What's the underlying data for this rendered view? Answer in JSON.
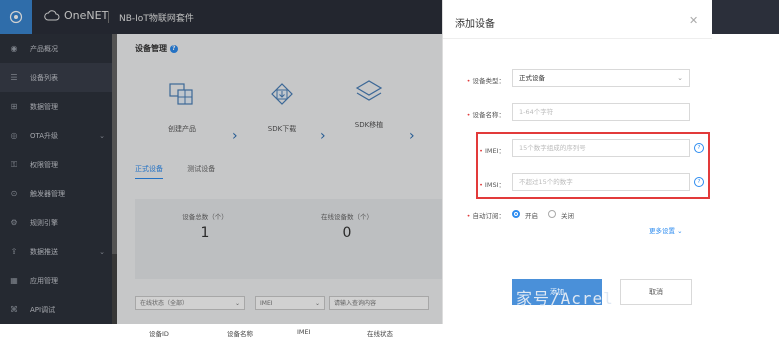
{
  "header": {
    "brand": "OneNET",
    "suite": "NB-IoT物联网套件"
  },
  "sidebar": {
    "items": [
      {
        "label": "产品概况",
        "icon": "dashboard-icon"
      },
      {
        "label": "设备列表",
        "icon": "list-icon",
        "active": true
      },
      {
        "label": "数据管理",
        "icon": "grid-icon"
      },
      {
        "label": "OTA升级",
        "icon": "upgrade-icon",
        "expandable": true
      },
      {
        "label": "权限管理",
        "icon": "key-icon"
      },
      {
        "label": "触发器管理",
        "icon": "trigger-icon"
      },
      {
        "label": "规则引擎",
        "icon": "rule-icon"
      },
      {
        "label": "数据推送",
        "icon": "push-icon",
        "expandable": true
      },
      {
        "label": "应用管理",
        "icon": "apps-icon"
      },
      {
        "label": "API调试",
        "icon": "api-icon"
      }
    ]
  },
  "main": {
    "title": "设备管理",
    "steps": [
      {
        "label": "创建产品"
      },
      {
        "label": "SDK下载"
      },
      {
        "label": "SDK移植"
      }
    ],
    "tabs": [
      {
        "label": "正式设备",
        "active": true
      },
      {
        "label": "测试设备",
        "active": false
      }
    ],
    "stats": [
      {
        "label": "设备总数（个）",
        "value": "1"
      },
      {
        "label": "在线设备数（个）",
        "value": "0"
      }
    ],
    "filters": {
      "status": "在线状态（全部）",
      "field": "IMEI",
      "search_placeholder": "请输入查询内容"
    },
    "table_headers": [
      "设备ID",
      "设备名称",
      "IMEI",
      "在线状态"
    ]
  },
  "modal": {
    "title": "添加设备",
    "fields": {
      "device_type": {
        "label": "设备类型：",
        "value": "正式设备"
      },
      "device_name": {
        "label": "设备名称：",
        "placeholder": "1-64个字符"
      },
      "imei": {
        "label": "IMEI：",
        "placeholder": "15个数字组成的序列号"
      },
      "imsi": {
        "label": "IMSI：",
        "placeholder": "不超过15个的数字"
      },
      "auto_subscribe": {
        "label": "自动订阅：",
        "options": [
          "开启",
          "关闭"
        ],
        "selected": "开启"
      }
    },
    "more_settings": "更多设置 ⌄",
    "buttons": {
      "confirm": "添加",
      "cancel": "取消"
    },
    "watermark": "家号/Acrel"
  },
  "colors": {
    "accent": "#2d8cf0",
    "highlight": "#e23a3a",
    "sidebar_bg": "#2e323c",
    "topbar_bg": "#2b2f3a"
  }
}
